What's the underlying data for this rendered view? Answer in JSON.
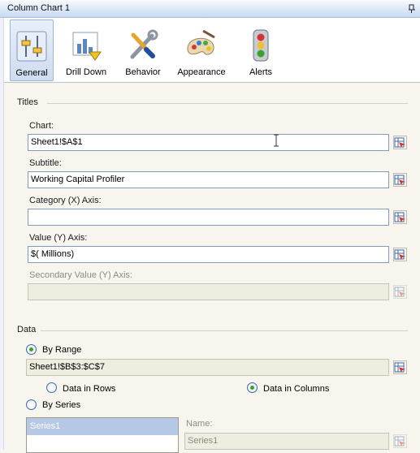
{
  "window": {
    "title": "Column Chart 1"
  },
  "tabs": [
    {
      "label": "General",
      "icon": "general-icon",
      "active": true
    },
    {
      "label": "Drill Down",
      "icon": "drill-down-icon",
      "active": false
    },
    {
      "label": "Behavior",
      "icon": "behavior-icon",
      "active": false
    },
    {
      "label": "Appearance",
      "icon": "appearance-icon",
      "active": false
    },
    {
      "label": "Alerts",
      "icon": "alerts-icon",
      "active": false
    }
  ],
  "titles": {
    "group_label": "Titles",
    "chart_label": "Chart:",
    "chart_value": "Sheet1!$A$1",
    "subtitle_label": "Subtitle:",
    "subtitle_value": "Working Capital Profiler",
    "category_label": "Category (X) Axis:",
    "category_value": "",
    "value_label": "Value (Y) Axis:",
    "value_value": "$( Millions)",
    "secondary_label": "Secondary Value (Y) Axis:",
    "secondary_value": ""
  },
  "data": {
    "group_label": "Data",
    "by_range_label": "By Range",
    "by_range_selected": true,
    "range_value": "Sheet1!$B$3:$C$7",
    "rows_label": "Data in Rows",
    "columns_label": "Data in Columns",
    "orientation_selected": "columns",
    "by_series_label": "By Series",
    "by_series_selected": false,
    "series": [
      "Series1"
    ],
    "name_label": "Name:",
    "name_value": "Series1"
  },
  "colors": {
    "accent": "#3aa12f",
    "field_border": "#7f9db9",
    "panel_bg": "#f7f5ee"
  }
}
